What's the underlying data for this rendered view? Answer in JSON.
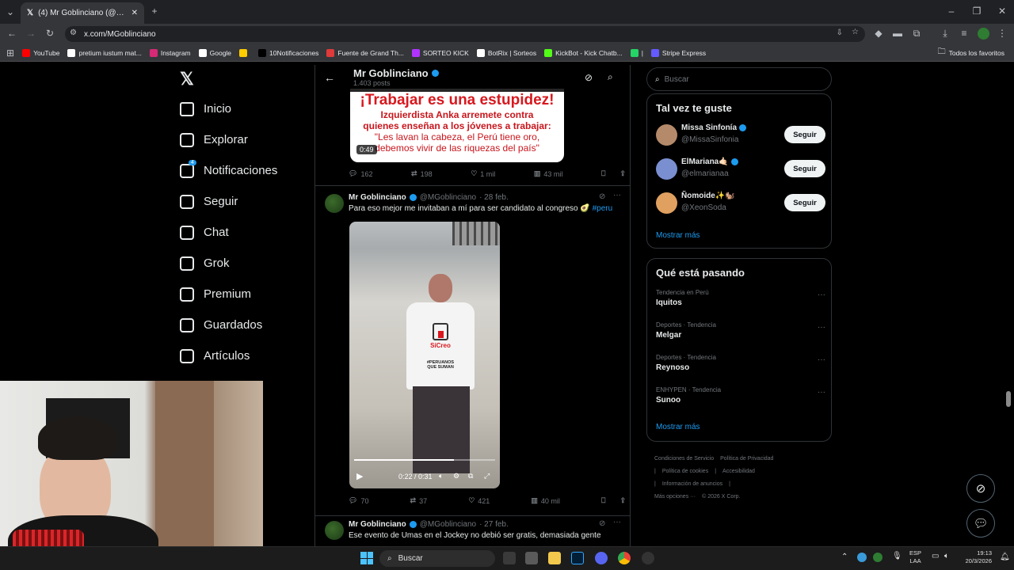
{
  "browser": {
    "tab_title": "(4) Mr Goblinciano (@MGoblinc",
    "url": "x.com/MGoblinciano",
    "bookmarks": [
      {
        "label": "YouTube",
        "color": "#ff0000"
      },
      {
        "label": "pretium iustum mat...",
        "color": "#ffffff"
      },
      {
        "label": "Instagram",
        "color": "#d62976"
      },
      {
        "label": "Google",
        "color": "#ffffff"
      },
      {
        "label": "",
        "color": "#ffcc00"
      },
      {
        "label": "10Notificaciones",
        "color": "#000000"
      },
      {
        "label": "Fuente de Grand Th...",
        "color": "#e03a3a"
      },
      {
        "label": "SORTEO KICK",
        "color": "#b033ff"
      },
      {
        "label": "BotRix | Sorteos",
        "color": "#ffffff"
      },
      {
        "label": "KickBot - Kick Chatb...",
        "color": "#53fc18"
      },
      {
        "label": "|",
        "color": "#25d366"
      },
      {
        "label": "Stripe Express",
        "color": "#635bff"
      }
    ],
    "all_bookmarks": "Todos los favoritos"
  },
  "nav": [
    {
      "label": "Inicio",
      "icon": "home-icon"
    },
    {
      "label": "Explorar",
      "icon": "search-icon"
    },
    {
      "label": "Notificaciones",
      "icon": "bell-icon",
      "badge": "4"
    },
    {
      "label": "Seguir",
      "icon": "follow-icon"
    },
    {
      "label": "Chat",
      "icon": "mail-icon"
    },
    {
      "label": "Grok",
      "icon": "grok-icon"
    },
    {
      "label": "Premium",
      "icon": "premium-icon"
    },
    {
      "label": "Guardados",
      "icon": "bookmark-icon"
    },
    {
      "label": "Artículos",
      "icon": "articles-icon"
    }
  ],
  "nav_partial": "es",
  "profile": {
    "name": "Mr Goblinciano",
    "posts": "1.403 posts"
  },
  "tweet1": {
    "headline": "¡Trabajar es una estupidez!",
    "sub1": "Izquierdista Anka arremete contra",
    "sub2": "quienes enseñan a los jóvenes a trabajar:",
    "quote1": "\"Les lavan la cabeza, el Perú tiene oro,",
    "quote2": "debemos vivir de las riquezas del país\"",
    "duration": "0:49",
    "replies": "162",
    "reposts": "198",
    "likes": "1 mil",
    "views": "43 mil"
  },
  "tweet2": {
    "name": "Mr Goblinciano",
    "handle": "@MGoblinciano",
    "date": "· 28 feb.",
    "text": "Para eso mejor me invitaban a mí para ser candidato al congreso 🥑",
    "hashtag": "#peru",
    "shirt_brand": "SíCreo",
    "shirt_slogan": "#PERUANOS QUE SUMAN",
    "time": "0:22 / 0:31",
    "progress": 0.71,
    "replies": "70",
    "reposts": "37",
    "likes": "421",
    "views": "40 mil"
  },
  "tweet3": {
    "name": "Mr Goblinciano",
    "handle": "@MGoblinciano",
    "date": "· 27 feb.",
    "text": "Ese evento de Umas en el Jockey no debió ser gratis, demasiada gente"
  },
  "right": {
    "search_placeholder": "Buscar",
    "suggest_title": "Tal vez te guste",
    "suggestions": [
      {
        "name": "Missa Sinfonía",
        "handle": "@MissaSinfonia",
        "follow": "Seguir"
      },
      {
        "name": "ElMariana🤙🏻",
        "handle": "@elmarianaa",
        "follow": "Seguir"
      },
      {
        "name": "Ñomoide✨🐿️",
        "handle": "@XeonSoda",
        "follow": "Seguir"
      }
    ],
    "show_more": "Mostrar más",
    "trends_title": "Qué está pasando",
    "trends": [
      {
        "cat": "Tendencia en Perú",
        "title": "Iquitos"
      },
      {
        "cat": "Deportes · Tendencia",
        "title": "Melgar"
      },
      {
        "cat": "Deportes · Tendencia",
        "title": "Reynoso"
      },
      {
        "cat": "ENHYPEN · Tendencia",
        "title": "Sunoo"
      }
    ],
    "show_more2": "Mostrar más",
    "footer": [
      "Condiciones de Servicio",
      "Política de Privacidad",
      "|",
      "Política de cookies",
      "|",
      "Accesibilidad",
      "|",
      "Información de anuncios",
      "|",
      "Más opciones ···",
      "© 2026 X Corp."
    ]
  },
  "taskbar": {
    "search": "Buscar",
    "lang1": "ESP",
    "lang2": "LAA",
    "time": "19:13",
    "date": "20/3/2026"
  }
}
